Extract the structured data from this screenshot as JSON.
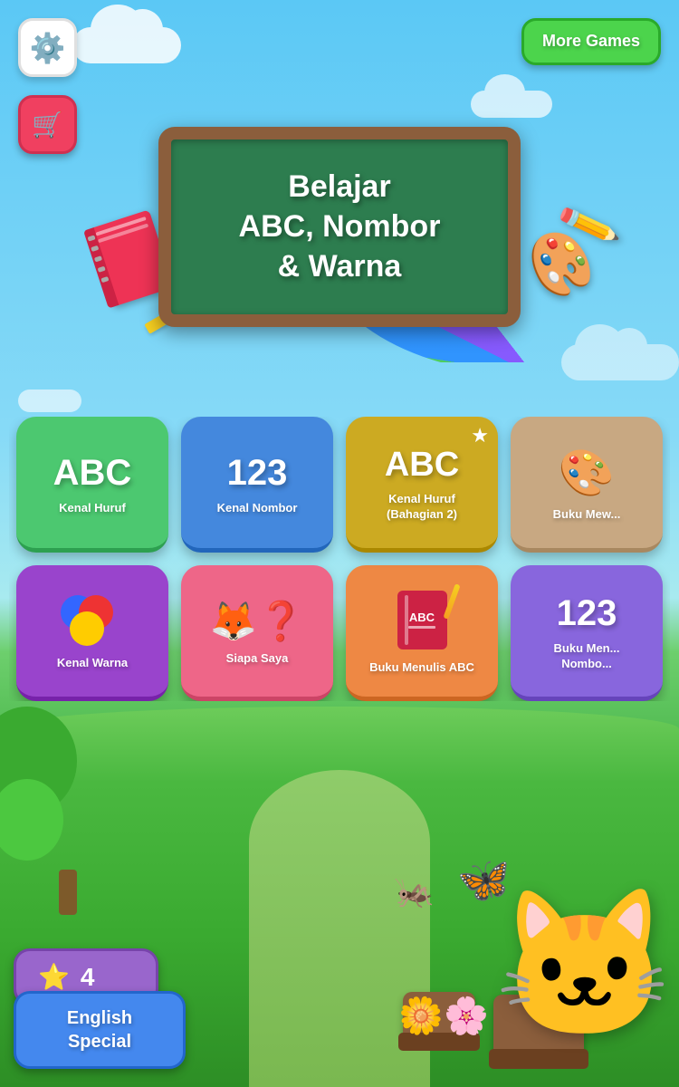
{
  "app": {
    "title": "Belajar ABC, Nombor & Warna"
  },
  "header": {
    "settings_label": "⚙",
    "cart_label": "🛒",
    "more_games_label": "More\nGames"
  },
  "chalkboard": {
    "line1": "Belajar",
    "line2": "ABC, Nombor",
    "line3": "& Warna"
  },
  "games": [
    {
      "id": "abc",
      "icon_text": "ABC",
      "label": "Kenal Huruf",
      "color_class": "card-abc",
      "icon_type": "text"
    },
    {
      "id": "123",
      "icon_text": "123",
      "label": "Kenal Nombor",
      "color_class": "card-123",
      "icon_type": "text"
    },
    {
      "id": "abc2",
      "icon_text": "ABC",
      "label": "Kenal Huruf\n(Bahagian 2)",
      "color_class": "card-abc2",
      "icon_type": "text_star"
    },
    {
      "id": "buku-mew",
      "icon_text": "🎨",
      "label": "Buku Mew...",
      "color_class": "card-buku-mew",
      "icon_type": "emoji"
    },
    {
      "id": "warna",
      "icon_text": "circles",
      "label": "Kenal Warna",
      "color_class": "card-warna",
      "icon_type": "circles"
    },
    {
      "id": "siapa",
      "icon_text": "🦊❓",
      "label": "Siapa Saya",
      "color_class": "card-siapa",
      "icon_type": "emoji"
    },
    {
      "id": "menulis",
      "icon_text": "book",
      "label": "Buku Menulis ABC",
      "color_class": "card-menulis",
      "icon_type": "book"
    },
    {
      "id": "nombor2",
      "icon_text": "123",
      "label": "Buku Men... Nombo...",
      "color_class": "card-nombor",
      "icon_type": "text"
    }
  ],
  "bottom": {
    "stars_count": "4",
    "english_special_label": "English\nSpecial"
  },
  "colors": {
    "accent_green": "#4cd44c",
    "accent_blue": "#4488ee",
    "accent_purple": "#9966cc",
    "settings_bg": "#ffffff",
    "cart_bg": "#f04060"
  }
}
